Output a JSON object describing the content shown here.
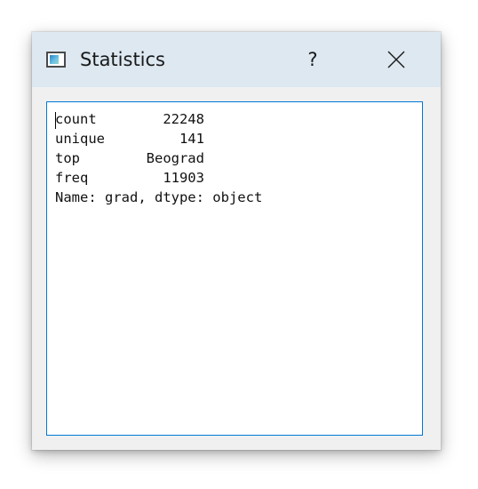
{
  "window": {
    "title": "Statistics",
    "help_label": "?",
    "close_icon": "close-x-icon",
    "app_icon": "window-app-icon"
  },
  "output": {
    "text": "count        22248\nunique         141\ntop        Beograd\nfreq         11903\nName: grad, dtype: object"
  },
  "colors": {
    "titlebar": "#dde8f1",
    "dialog_bg": "#f0f0f0",
    "textbox_border": "#0078d7"
  }
}
